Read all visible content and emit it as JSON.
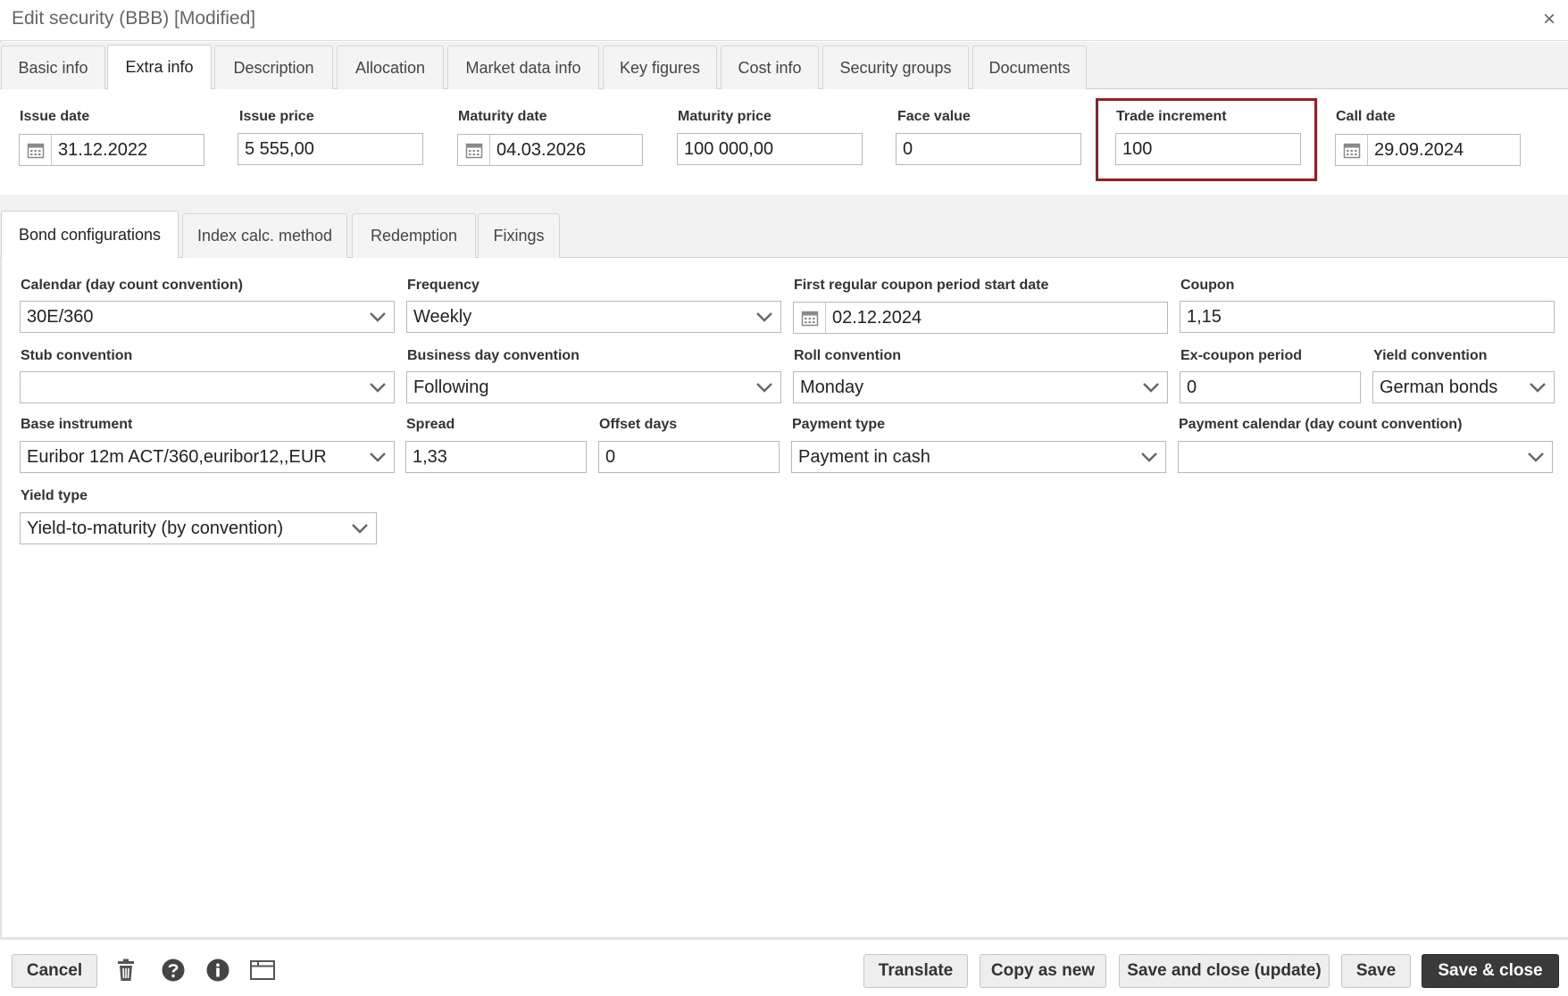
{
  "window": {
    "title": "Edit security (BBB) [Modified]",
    "close_glyph": "×"
  },
  "top_tabs": [
    {
      "label": "Basic info"
    },
    {
      "label": "Extra info",
      "active": true
    },
    {
      "label": "Description"
    },
    {
      "label": "Allocation"
    },
    {
      "label": "Market data info"
    },
    {
      "label": "Key figures"
    },
    {
      "label": "Cost info"
    },
    {
      "label": "Security groups"
    },
    {
      "label": "Documents"
    }
  ],
  "extra_info": {
    "issue_date": {
      "label": "Issue date",
      "value": "31.12.2022"
    },
    "issue_price": {
      "label": "Issue price",
      "value": "5 555,00"
    },
    "maturity_date": {
      "label": "Maturity date",
      "value": "04.03.2026"
    },
    "maturity_price": {
      "label": "Maturity price",
      "value": "100 000,00"
    },
    "face_value": {
      "label": "Face value",
      "value": "0"
    },
    "trade_increment": {
      "label": "Trade increment",
      "value": "100"
    },
    "call_date": {
      "label": "Call date",
      "value": "29.09.2024"
    }
  },
  "sub_tabs": [
    {
      "label": "Bond configurations",
      "active": true
    },
    {
      "label": "Index calc. method"
    },
    {
      "label": "Redemption"
    },
    {
      "label": "Fixings"
    }
  ],
  "bond": {
    "calendar": {
      "label": "Calendar (day count convention)",
      "value": "30E/360"
    },
    "frequency": {
      "label": "Frequency",
      "value": "Weekly"
    },
    "first_coupon": {
      "label": "First regular coupon period start date",
      "value": "02.12.2024"
    },
    "coupon": {
      "label": "Coupon",
      "value": "1,15"
    },
    "stub": {
      "label": "Stub convention",
      "value": ""
    },
    "business_day": {
      "label": "Business day convention",
      "value": "Following"
    },
    "roll": {
      "label": "Roll convention",
      "value": "Monday"
    },
    "ex_coupon": {
      "label": "Ex-coupon period",
      "value": "0"
    },
    "yield_convention": {
      "label": "Yield convention",
      "value": "German bonds"
    },
    "base_instrument": {
      "label": "Base instrument",
      "value": "Euribor 12m ACT/360,euribor12,,EUR"
    },
    "spread": {
      "label": "Spread",
      "value": "1,33"
    },
    "offset_days": {
      "label": "Offset days",
      "value": "0"
    },
    "payment_type": {
      "label": "Payment type",
      "value": "Payment in cash"
    },
    "payment_calendar": {
      "label": "Payment calendar (day count convention)",
      "value": ""
    },
    "yield_type": {
      "label": "Yield type",
      "value": "Yield-to-maturity (by convention)"
    }
  },
  "footer": {
    "cancel": "Cancel",
    "translate": "Translate",
    "copy_as_new": "Copy as new",
    "save_close_update": "Save and close (update)",
    "save": "Save",
    "save_close": "Save & close"
  },
  "colors": {
    "highlight": "#9b1c24",
    "primary_button": "#3a3a3a"
  }
}
